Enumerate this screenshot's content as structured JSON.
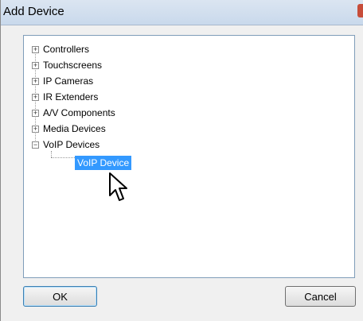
{
  "window": {
    "title": "Add Device"
  },
  "tree": {
    "items": [
      {
        "label": "Controllers",
        "expander": "+"
      },
      {
        "label": "Touchscreens",
        "expander": "+"
      },
      {
        "label": "IP Cameras",
        "expander": "+"
      },
      {
        "label": "IR Extenders",
        "expander": "+"
      },
      {
        "label": "A/V Components",
        "expander": "+"
      },
      {
        "label": "Media Devices",
        "expander": "+"
      },
      {
        "label": "VoIP Devices",
        "expander": "−"
      }
    ],
    "selected_child": {
      "label": "VoIP Device"
    }
  },
  "buttons": {
    "ok": "OK",
    "cancel": "Cancel"
  },
  "icons": {
    "cursor": "arrow-pointer-icon",
    "close": "close-icon"
  }
}
